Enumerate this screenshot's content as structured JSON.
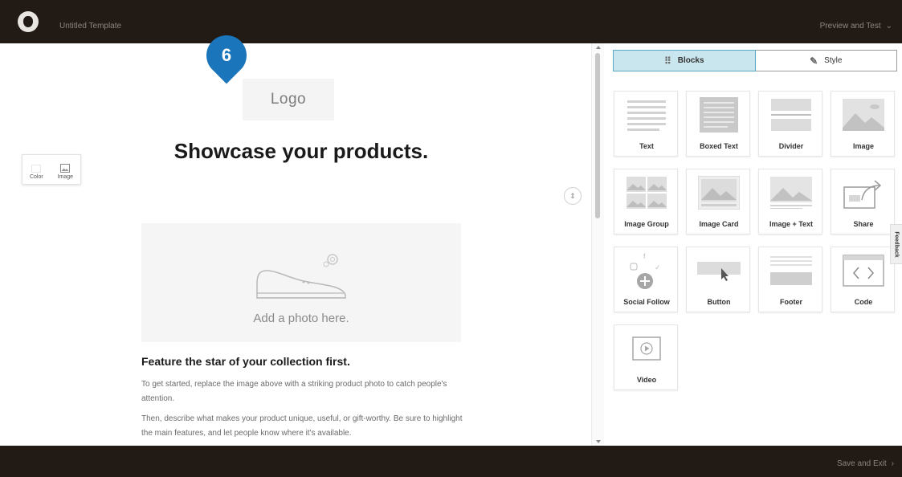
{
  "header": {
    "template_title": "Untitled Template",
    "preview_label": "Preview and Test"
  },
  "footer": {
    "save_label": "Save and Exit"
  },
  "step_badge": "6",
  "email": {
    "logo_placeholder": "Logo",
    "headline": "Showcase your products.",
    "photo_placeholder": "Add a photo here.",
    "feature_title": "Feature the star of your collection first.",
    "paragraph1": "To get started, replace the image above with a striking product photo to catch people's attention.",
    "paragraph2": "Then, describe what makes your product unique, useful, or gift-worthy. Be sure to highlight the main features, and let people know where it's available."
  },
  "background_tool": {
    "color_label": "Color",
    "image_label": "Image"
  },
  "panel": {
    "tabs": [
      {
        "label": "Blocks",
        "icon": "grid-icon",
        "active": true
      },
      {
        "label": "Style",
        "icon": "brush-icon",
        "active": false
      }
    ],
    "blocks": [
      {
        "label": "Text",
        "icon": "text-block-icon"
      },
      {
        "label": "Boxed Text",
        "icon": "boxed-text-icon"
      },
      {
        "label": "Divider",
        "icon": "divider-icon"
      },
      {
        "label": "Image",
        "icon": "image-icon"
      },
      {
        "label": "Image Group",
        "icon": "image-group-icon"
      },
      {
        "label": "Image Card",
        "icon": "image-card-icon"
      },
      {
        "label": "Image + Text",
        "icon": "image-text-icon"
      },
      {
        "label": "Share",
        "icon": "share-icon"
      },
      {
        "label": "Social Follow",
        "icon": "social-follow-icon"
      },
      {
        "label": "Button",
        "icon": "button-block-icon"
      },
      {
        "label": "Footer",
        "icon": "footer-icon"
      },
      {
        "label": "Code",
        "icon": "code-icon"
      },
      {
        "label": "Video",
        "icon": "video-icon"
      }
    ]
  },
  "feedback_label": "Feedback",
  "colors": {
    "topbar": "#221a14",
    "accent_tab": "#c9e6ef",
    "badge": "#1b75ba"
  }
}
